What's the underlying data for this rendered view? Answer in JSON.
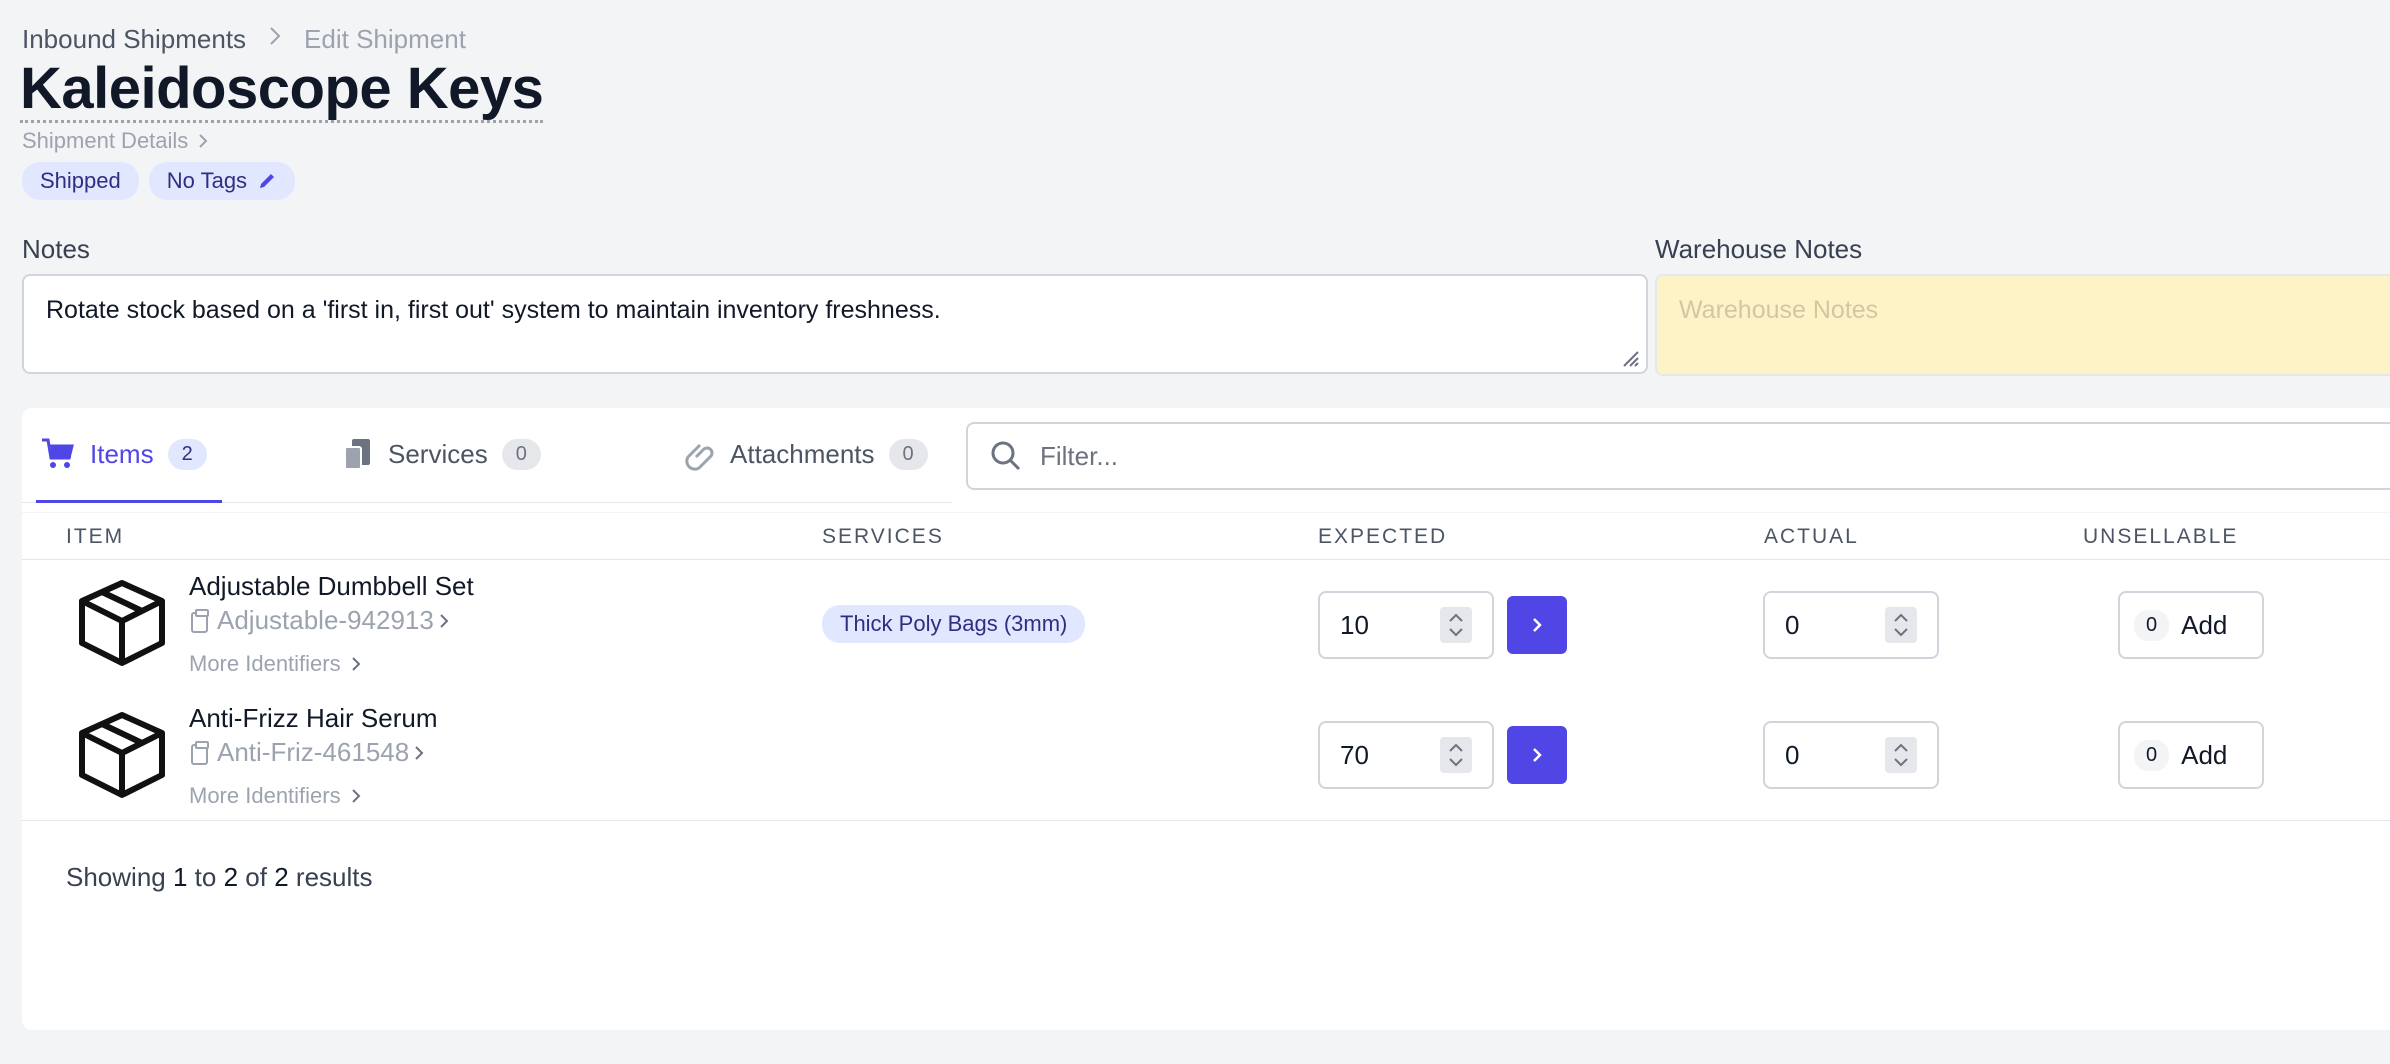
{
  "breadcrumb": {
    "parent": "Inbound Shipments",
    "current": "Edit Shipment"
  },
  "page_title": "Kaleidoscope Keys",
  "shipment_details_link": "Shipment Details",
  "badges": {
    "status": "Shipped",
    "tags": "No Tags"
  },
  "notes": {
    "label": "Notes",
    "value": "Rotate stock based on a 'first in, first out' system to maintain inventory freshness."
  },
  "warehouse_notes": {
    "label": "Warehouse Notes",
    "placeholder": "Warehouse Notes"
  },
  "tabs": [
    {
      "label": "Items",
      "count": "2",
      "icon": "cart-icon",
      "active": true
    },
    {
      "label": "Services",
      "count": "0",
      "icon": "clipboard-icon",
      "active": false
    },
    {
      "label": "Attachments",
      "count": "0",
      "icon": "paperclip-icon",
      "active": false
    }
  ],
  "filter": {
    "placeholder": "Filter..."
  },
  "table": {
    "headers": {
      "item": "ITEM",
      "services": "SERVICES",
      "expected": "EXPECTED",
      "actual": "ACTUAL",
      "unsellable": "UNSELLABLE"
    },
    "rows": [
      {
        "name": "Adjustable Dumbbell Set",
        "sku": "Adjustable-942913",
        "more": "More Identifiers",
        "service": "Thick Poly Bags (3mm)",
        "expected": "10",
        "actual": "0",
        "unsellable": "0",
        "add": "Add"
      },
      {
        "name": "Anti-Frizz Hair Serum",
        "sku": "Anti-Friz-461548",
        "more": "More Identifiers",
        "service": "",
        "expected": "70",
        "actual": "0",
        "unsellable": "0",
        "add": "Add"
      }
    ]
  },
  "footer": {
    "showing": "Showing",
    "from": "1",
    "to_word": "to",
    "to": "2",
    "of_word": "of",
    "total": "2",
    "results": "results"
  },
  "colors": {
    "accent": "#4f46e5",
    "badge_bg": "#e0e7ff",
    "warehouse_bg": "#fef3c7"
  }
}
